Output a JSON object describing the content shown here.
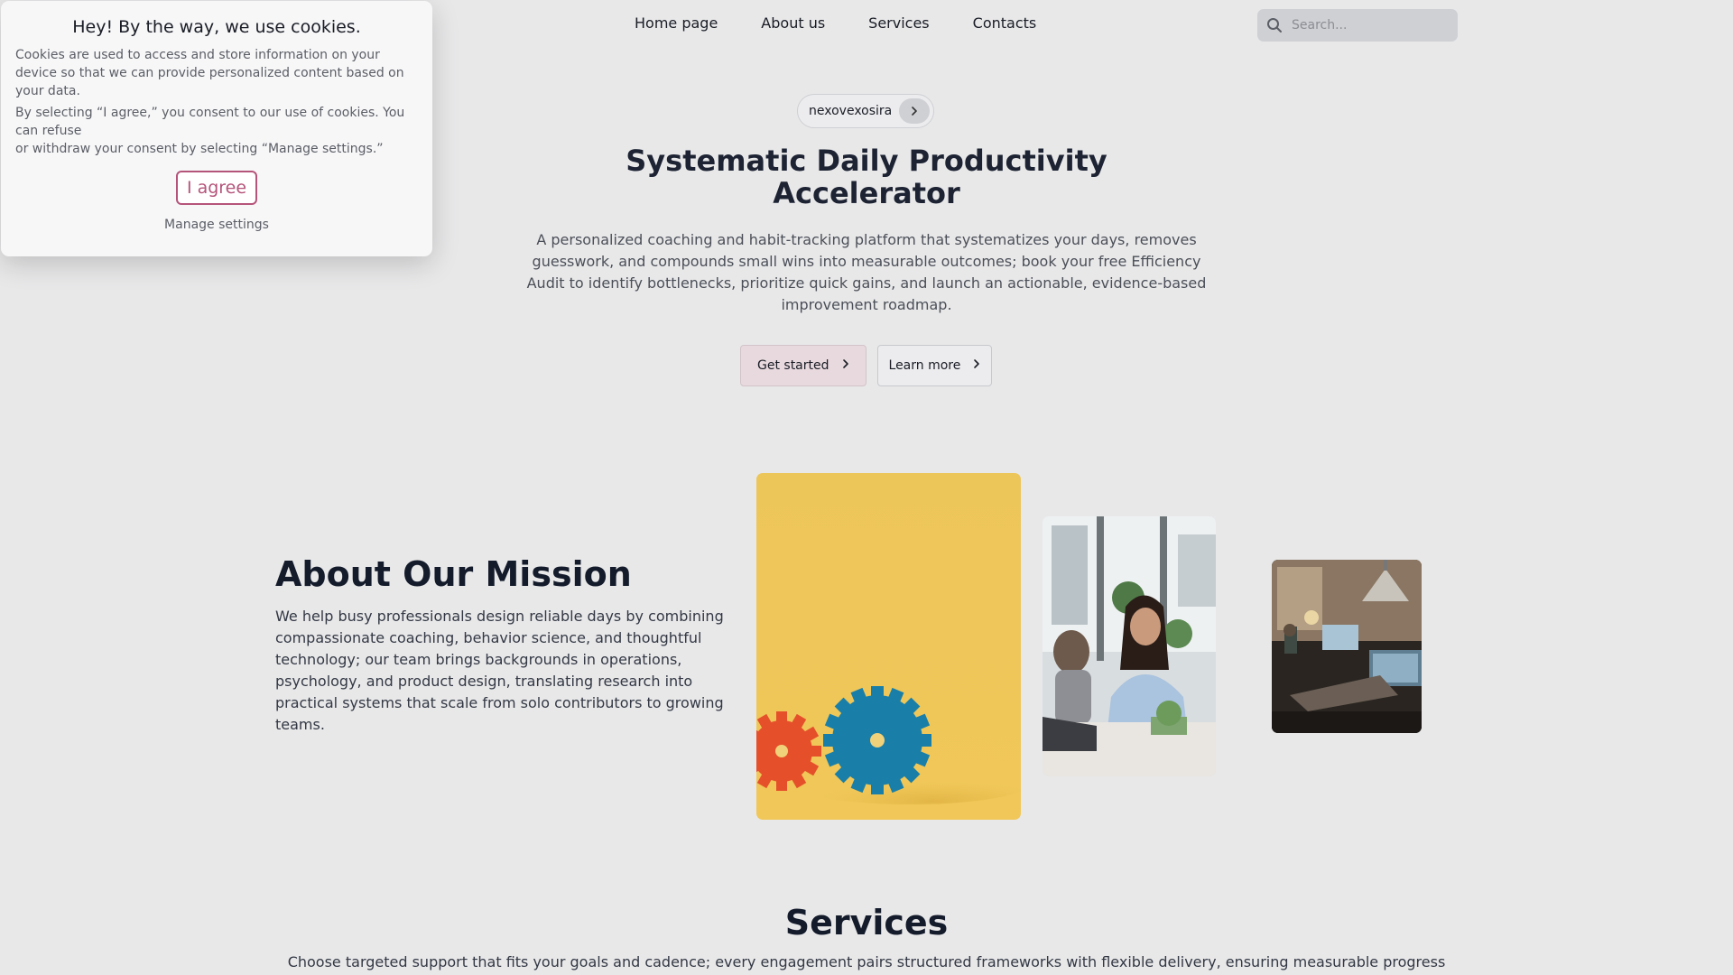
{
  "nav": {
    "links": [
      "Home page",
      "About us",
      "Services",
      "Contacts"
    ],
    "search_placeholder": "Search..."
  },
  "cookie": {
    "title": "Hey! By the way, we use cookies.",
    "text1": "Cookies are used to access and store information on your device so that we can provide personalized content based on your data.",
    "text2": "By selecting “I agree,” you consent to our use of cookies. You can refuse",
    "text3": "or withdraw your consent by selecting “Manage settings.”",
    "agree_label": "I agree",
    "manage_label": "Manage settings"
  },
  "hero": {
    "badge": "nexovexosira",
    "title": "Systematic Daily Productivity Accelerator",
    "description": "A personalized coaching and habit-tracking platform that systematizes your days, removes guesswork, and compounds small wins into measurable outcomes; book your free Efficiency Audit to identify bottlenecks, prioritize quick gains, and launch an actionable, evidence-based improvement roadmap.",
    "primary_label": "Get started",
    "secondary_label": "Learn more"
  },
  "about": {
    "title": "About Our Mission",
    "text": "We help busy professionals design reliable days by combining compassionate coaching, behavior science, and thoughtful technology; our team brings backgrounds in operations, psychology, and product design, translating research into practical systems that scale from solo contributors to growing teams."
  },
  "services": {
    "title": "Services",
    "description": "Choose targeted support that fits your goals and cadence; every engagement pairs structured frameworks with flexible delivery, ensuring measurable progress"
  },
  "colors": {
    "background": "#e8e8e9",
    "accent": "#b5547a",
    "primary_button": "#e8d9de",
    "heading": "#141b2b"
  }
}
